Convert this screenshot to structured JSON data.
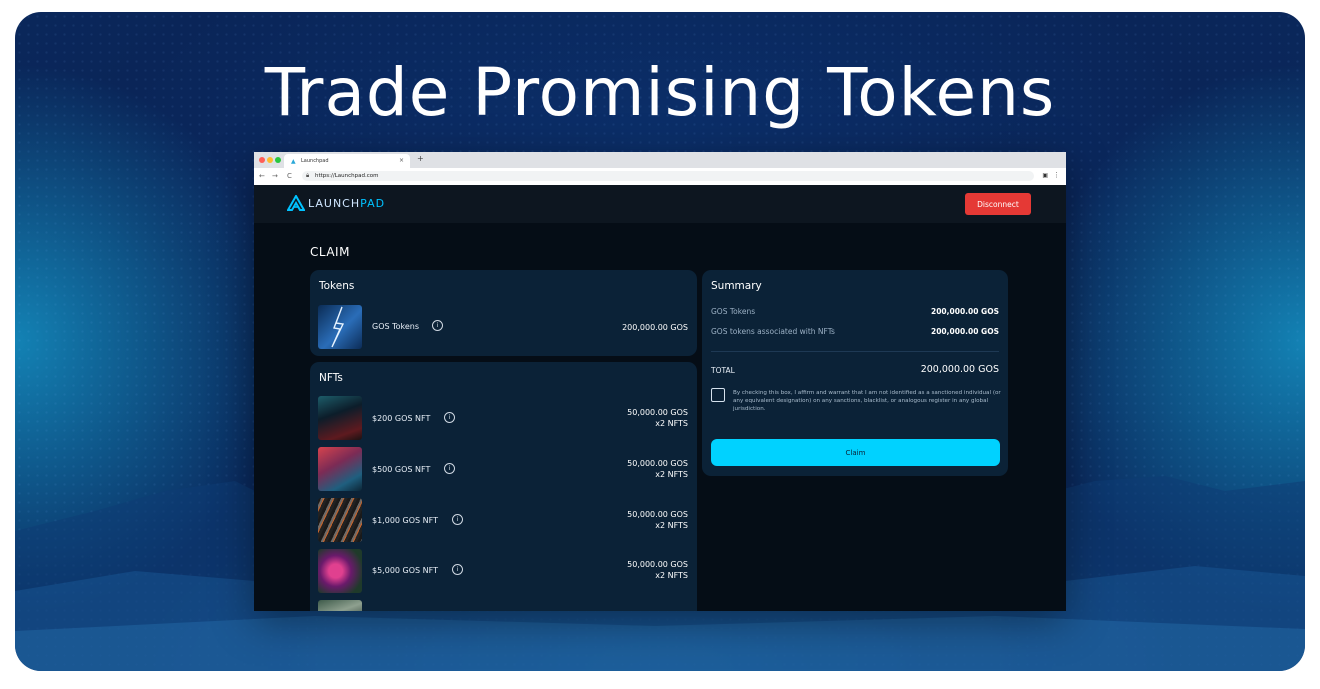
{
  "hero": {
    "title": "Trade Promising Tokens"
  },
  "browser": {
    "tab_label": "Launchpad",
    "tab_close": "×",
    "new_tab": "+",
    "back": "←",
    "forward": "→",
    "reload": "C",
    "url": "https://Launchpad.com"
  },
  "app": {
    "logo_text_a": "LAUNCH",
    "logo_text_b": "PAD",
    "disconnect_label": "Disconnect",
    "page_title": "CLAIM",
    "tokens": {
      "title": "Tokens",
      "items": [
        {
          "label": "GOS Tokens",
          "value": "200,000.00 GOS"
        }
      ]
    },
    "nfts": {
      "title": "NFTs",
      "items": [
        {
          "label": "$200 GOS NFT",
          "value": "50,000.00 GOS",
          "count": "x2 NFTS"
        },
        {
          "label": "$500 GOS NFT",
          "value": "50,000.00 GOS",
          "count": "x2 NFTS"
        },
        {
          "label": "$1,000 GOS NFT",
          "value": "50,000.00 GOS",
          "count": "x2 NFTS"
        },
        {
          "label": "$5,000 GOS NFT",
          "value": "50,000.00 GOS",
          "count": "x2 NFTS"
        }
      ]
    },
    "summary": {
      "title": "Summary",
      "rows": [
        {
          "label": "GOS Tokens",
          "value": "200,000.00 GOS"
        },
        {
          "label": "GOS tokens associated with NFTs",
          "value": "200,000.00 GOS"
        }
      ],
      "total_label": "TOTAL",
      "total_value": "200,000.00 GOS",
      "legal_text": "By checking this box, I affirm and warrant that I am not identified as a sanctioned individual (or any equivalent designation) on any sanctions, blacklist, or analogous register in any global jurisdiction.",
      "claim_label": "Claim"
    },
    "info_glyph": "i"
  },
  "colors": {
    "accent": "#00d2ff",
    "danger": "#e53935",
    "card": "#0b2237",
    "background": "#050d16"
  }
}
